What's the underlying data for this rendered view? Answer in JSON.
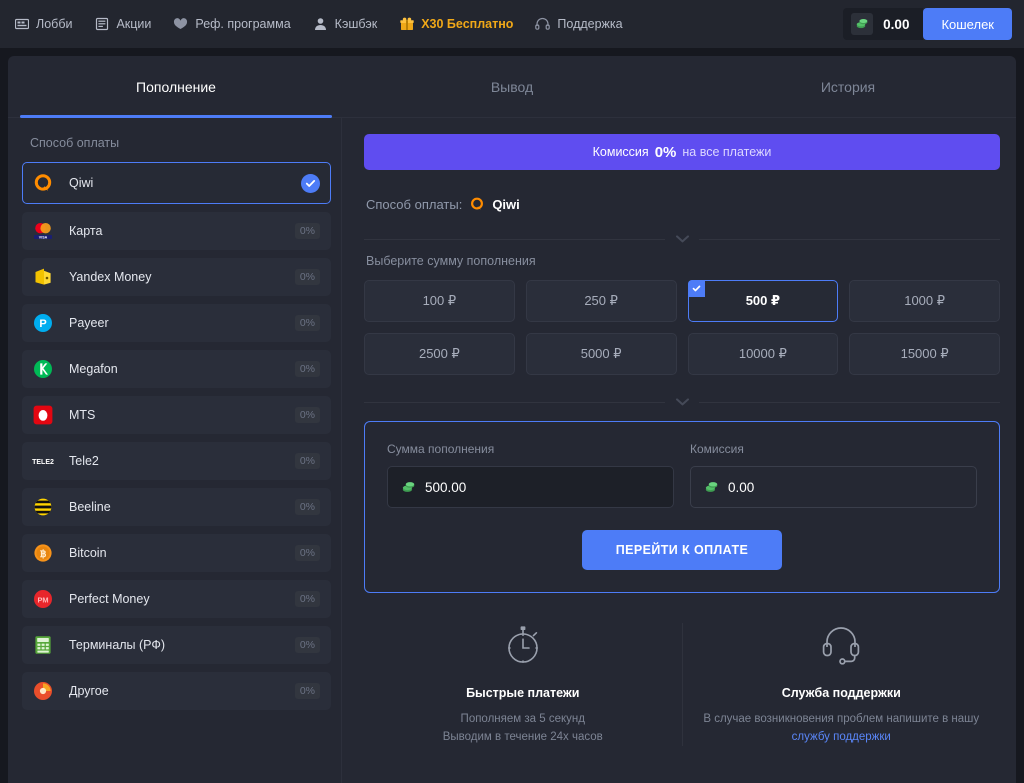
{
  "topnav": {
    "items": [
      {
        "label": "Лобби",
        "icon": "lobby-icon",
        "highlight": false
      },
      {
        "label": "Акции",
        "icon": "promotions-icon",
        "highlight": false
      },
      {
        "label": "Реф. программа",
        "icon": "referral-icon",
        "highlight": false
      },
      {
        "label": "Кэшбэк",
        "icon": "user-icon",
        "highlight": false
      },
      {
        "label": "X30 Бесплатно",
        "icon": "gift-icon",
        "highlight": true
      },
      {
        "label": "Поддержка",
        "icon": "headset-icon",
        "highlight": false
      }
    ],
    "balance": "0.00",
    "wallet_button": "Кошелек"
  },
  "tabs": [
    {
      "label": "Пополнение",
      "active": true
    },
    {
      "label": "Вывод",
      "active": false
    },
    {
      "label": "История",
      "active": false
    }
  ],
  "sidebar": {
    "title": "Способ оплаты",
    "methods": [
      {
        "label": "Qiwi",
        "icon": "qiwi-icon",
        "fee": "",
        "selected": true
      },
      {
        "label": "Карта",
        "icon": "card-icon",
        "fee": "0%",
        "selected": false
      },
      {
        "label": "Yandex Money",
        "icon": "yandex-money-icon",
        "fee": "0%",
        "selected": false
      },
      {
        "label": "Payeer",
        "icon": "payeer-icon",
        "fee": "0%",
        "selected": false
      },
      {
        "label": "Megafon",
        "icon": "megafon-icon",
        "fee": "0%",
        "selected": false
      },
      {
        "label": "MTS",
        "icon": "mts-icon",
        "fee": "0%",
        "selected": false
      },
      {
        "label": "Tele2",
        "icon": "tele2-icon",
        "fee": "0%",
        "selected": false
      },
      {
        "label": "Beeline",
        "icon": "beeline-icon",
        "fee": "0%",
        "selected": false
      },
      {
        "label": "Bitcoin",
        "icon": "bitcoin-icon",
        "fee": "0%",
        "selected": false
      },
      {
        "label": "Perfect Money",
        "icon": "perfect-money-icon",
        "fee": "0%",
        "selected": false
      },
      {
        "label": "Терминалы (РФ)",
        "icon": "terminal-icon",
        "fee": "0%",
        "selected": false
      },
      {
        "label": "Другое",
        "icon": "other-icon",
        "fee": "0%",
        "selected": false
      }
    ]
  },
  "main": {
    "banner": {
      "prefix": "Комиссия",
      "percent": "0%",
      "suffix": "на все платежи"
    },
    "method_line": {
      "label": "Способ оплаты:",
      "value": "Qiwi",
      "icon": "qiwi-icon"
    },
    "amount_section_title": "Выберите сумму пополнения",
    "amounts": [
      {
        "label": "100 ₽",
        "selected": false
      },
      {
        "label": "250 ₽",
        "selected": false
      },
      {
        "label": "500 ₽",
        "selected": true
      },
      {
        "label": "1000 ₽",
        "selected": false
      },
      {
        "label": "2500 ₽",
        "selected": false
      },
      {
        "label": "5000 ₽",
        "selected": false
      },
      {
        "label": "10000 ₽",
        "selected": false
      },
      {
        "label": "15000 ₽",
        "selected": false
      }
    ],
    "form": {
      "amount_label": "Сумма пополнения",
      "amount_value": "500.00",
      "commission_label": "Комиссия",
      "commission_value": "0.00",
      "pay_button": "ПЕРЕЙТИ К ОПЛАТЕ"
    },
    "info": {
      "fast": {
        "icon": "stopwatch-icon",
        "title": "Быстрые платежи",
        "line1": "Пополняем за 5 секунд",
        "line2": "Выводим в течение 24х часов"
      },
      "support": {
        "icon": "headset-icon",
        "title": "Служба поддержки",
        "line1": "В случае возникновения проблем напишите в нашу",
        "link": "службу поддержки"
      }
    }
  },
  "colors": {
    "accent_blue": "#4d7cf7",
    "banner_purple": "#5f4df0",
    "promo_gold": "#f0a818",
    "page_bg": "#16181f",
    "card_bg": "#252833",
    "row_bg": "#2a2e3a"
  }
}
